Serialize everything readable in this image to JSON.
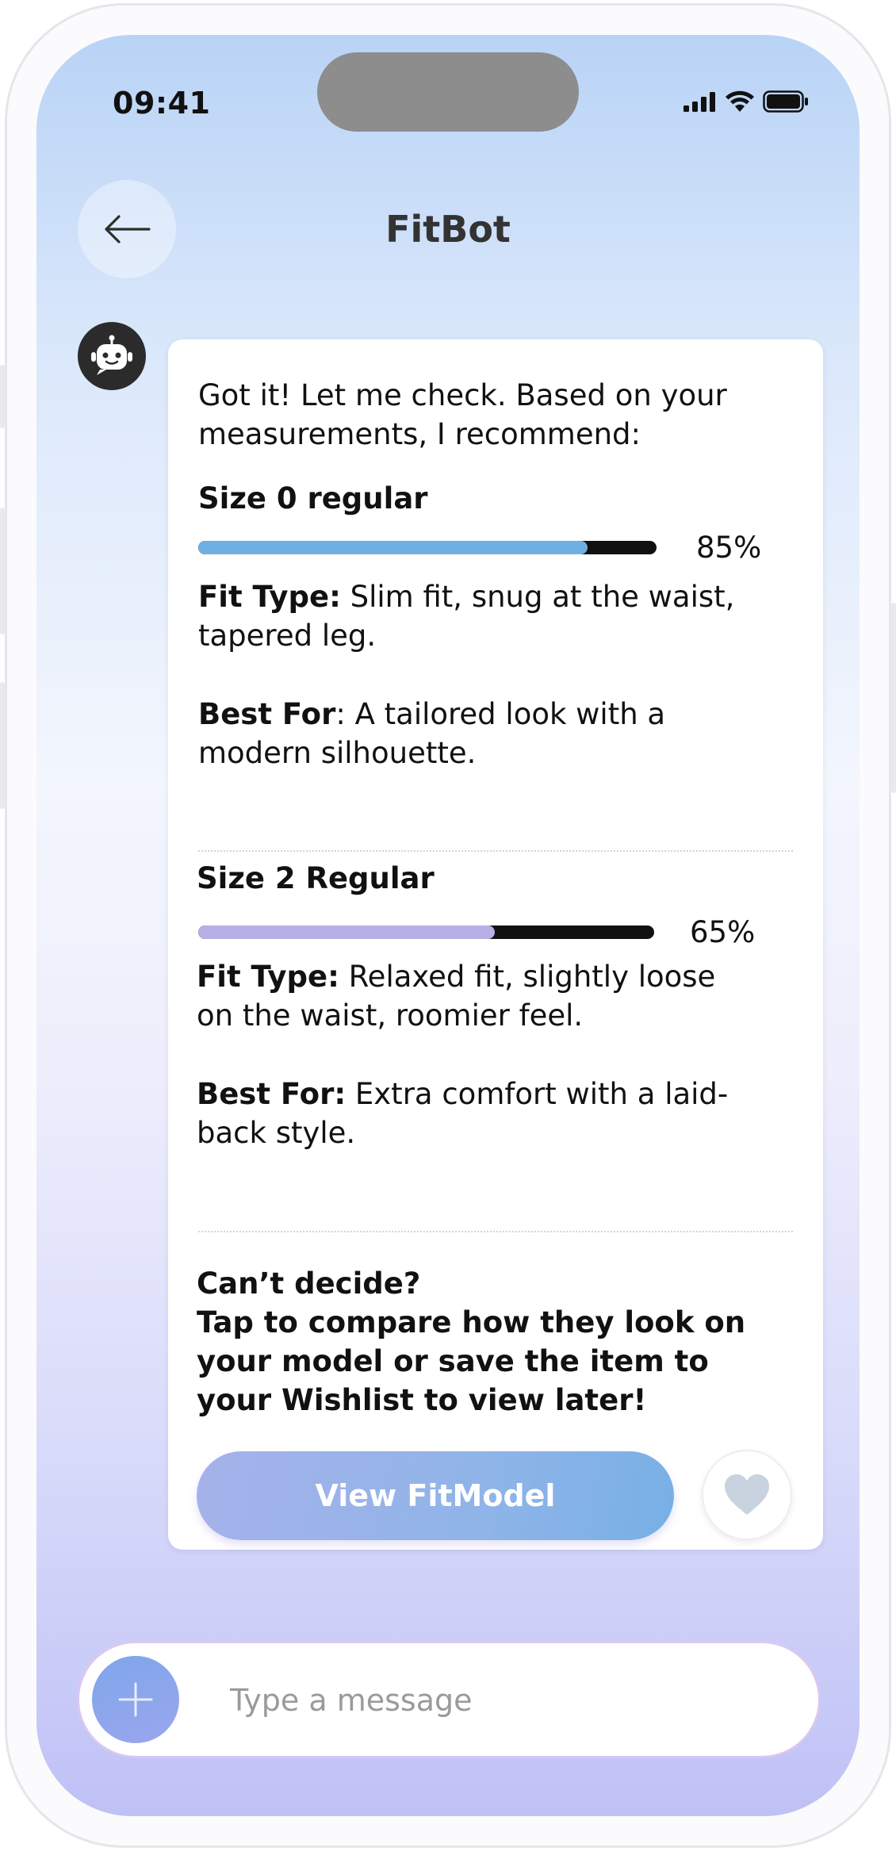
{
  "status_bar": {
    "time": "09:41"
  },
  "header": {
    "title": "FitBot",
    "back_icon": "arrow-left-icon"
  },
  "bot": {
    "avatar_icon": "robot-icon"
  },
  "message": {
    "intro": "Got it! Let me check. Based on your measurements, I recommend:",
    "sizes": [
      {
        "name": "Size 0 regular",
        "match": 0.85,
        "match_label": "85%",
        "bar_color": "#6fb0e4",
        "fit_type_label": "Fit Type:",
        "fit_type": "Slim fit, snug at the waist, tapered leg.",
        "best_for_label": "Best For",
        "best_for": ": A tailored look with a modern silhouette."
      },
      {
        "name": "Size 2 Regular",
        "match": 0.65,
        "match_label": "65%",
        "bar_color": "#b7b0e6",
        "fit_type_label": "Fit Type:",
        "fit_type": "Relaxed fit, slightly loose on the waist, roomier feel.",
        "best_for_label": "Best For:",
        "best_for": "Extra comfort with a laid-back style."
      }
    ],
    "cta_line1": "Can’t decide?",
    "cta_line2": "Tap to compare how they look on your model or save the item to your Wishlist to view later!",
    "view_button": "View FitModel",
    "wishlist_icon": "heart-icon"
  },
  "composer": {
    "placeholder": "Type a message",
    "add_icon": "plus-icon"
  }
}
